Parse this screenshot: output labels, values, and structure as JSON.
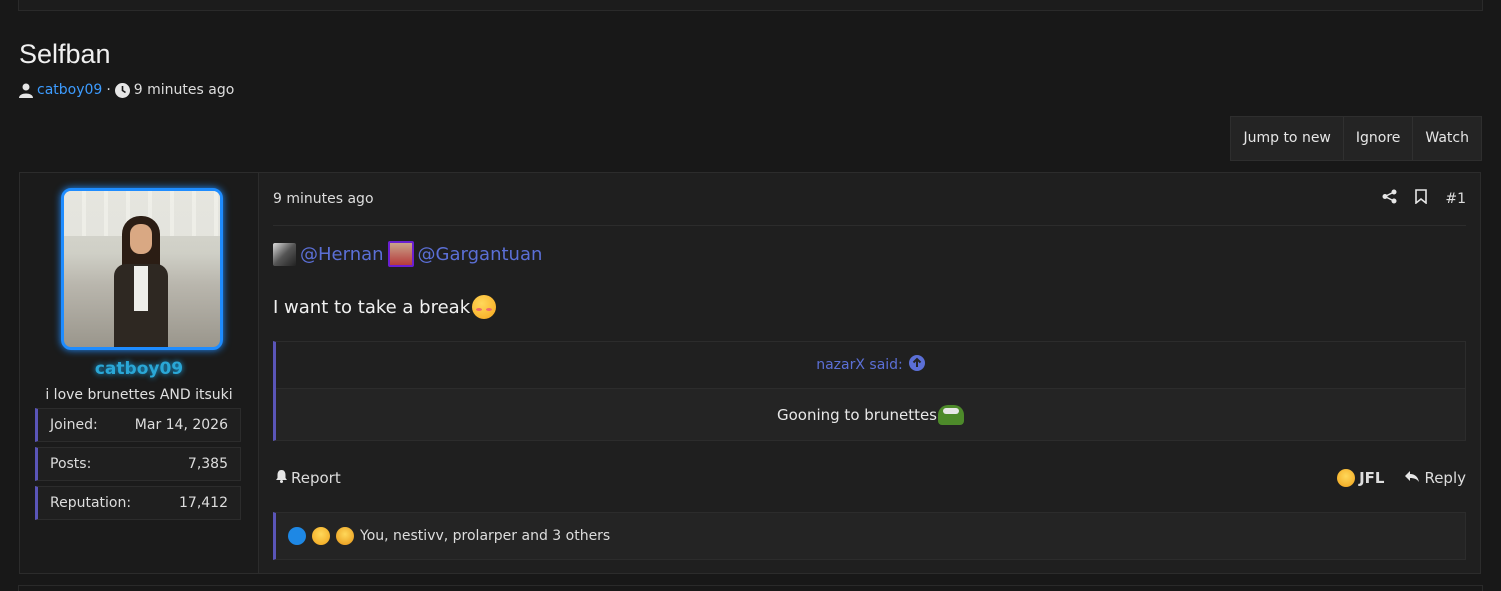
{
  "thread": {
    "title": "Selfban",
    "author": "catboy09",
    "time": "9 minutes ago"
  },
  "actions": [
    "Jump to new",
    "Ignore",
    "Watch"
  ],
  "user": {
    "name": "catboy09",
    "title": "i love brunettes AND itsuki",
    "stats": [
      {
        "label": "Joined:",
        "value": "Mar 14, 2026"
      },
      {
        "label": "Posts:",
        "value": "7,385"
      },
      {
        "label": "Reputation:",
        "value": "17,412"
      }
    ]
  },
  "post": {
    "date": "9 minutes ago",
    "number": "#1",
    "mentions": [
      "@Hernan",
      "@Gargantuan"
    ],
    "text": "I want to take a break",
    "quote": {
      "author": "nazarX said:",
      "text": "Gooning to brunettes"
    },
    "report_label": "Report",
    "jfl_label": "JFL",
    "reply_label": "Reply",
    "reactions_text": "You, nestivv, prolarper and 3 others"
  },
  "colors": {
    "accent": "#5a55b8",
    "link": "#3d9cff",
    "mention": "#5b6fd6",
    "username_glow": "#2aa7d6"
  }
}
